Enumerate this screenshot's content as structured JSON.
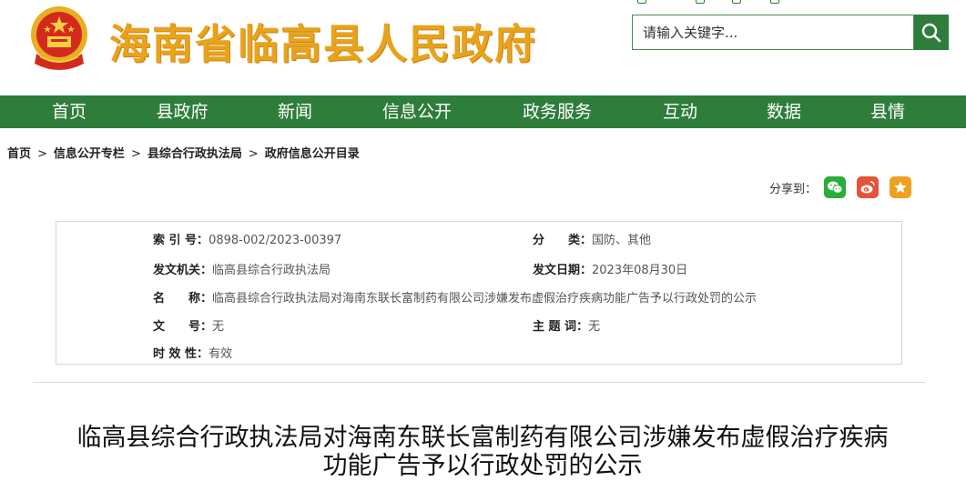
{
  "header": {
    "site_title": "海南省临高县人民政府",
    "search_placeholder": "请输入关键字..."
  },
  "nav": {
    "items": [
      {
        "label": "首页"
      },
      {
        "label": "县政府"
      },
      {
        "label": "新闻"
      },
      {
        "label": "信息公开"
      },
      {
        "label": "政务服务"
      },
      {
        "label": "互动"
      },
      {
        "label": "数据"
      },
      {
        "label": "县情"
      }
    ]
  },
  "breadcrumb": {
    "items": [
      "首页",
      "信息公开专栏",
      "县综合行政执法局",
      "政府信息公开目录"
    ],
    "separator": ">"
  },
  "share": {
    "label": "分享到："
  },
  "info": {
    "index_label": "索 引 号：",
    "index_value": "0898-002/2023-00397",
    "category_label": "分　　类：",
    "category_value": "国防、其他",
    "issuer_label": "发文机关：",
    "issuer_value": "临高县综合行政执法局",
    "date_label": "发文日期：",
    "date_value": "2023年08月30日",
    "name_label": "名　　称：",
    "name_value": "临高县综合行政执法局对海南东联长富制药有限公司涉嫌发布虚假治疗疾病功能广告予以行政处罚的公示",
    "doc_no_label": "文　　号：",
    "doc_no_value": "无",
    "subject_label": "主 题 词：",
    "subject_value": "无",
    "validity_label": "时 效 性：",
    "validity_value": "有效"
  },
  "article": {
    "title_line1": "临高县综合行政执法局对海南东联长富制药有限公司涉嫌发布虚假治疗疾病",
    "title_line2": "功能广告予以行政处罚的公示"
  },
  "colors": {
    "brand_green": "#2e7d3a",
    "title_gold": "#e8a31a",
    "wechat": "#2aae3a",
    "weibo": "#e6523a",
    "favorite": "#f0a020"
  }
}
